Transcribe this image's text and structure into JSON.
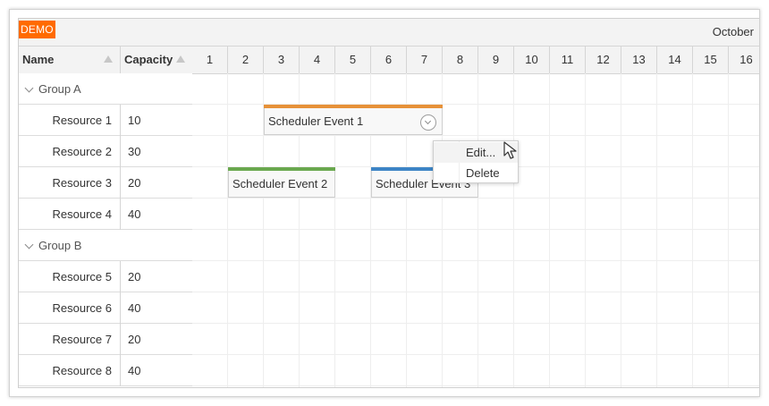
{
  "brand": {
    "demo_label": "DEMO"
  },
  "columns": {
    "name": "Name",
    "capacity": "Capacity"
  },
  "timeline": {
    "month": "October",
    "days": [
      "1",
      "2",
      "3",
      "4",
      "5",
      "6",
      "7",
      "8",
      "9",
      "10",
      "11",
      "12",
      "13",
      "14",
      "15",
      "16"
    ]
  },
  "groups": [
    {
      "label": "Group A",
      "resources": [
        {
          "name": "Resource 1",
          "capacity": "10"
        },
        {
          "name": "Resource 2",
          "capacity": "30"
        },
        {
          "name": "Resource 3",
          "capacity": "20"
        },
        {
          "name": "Resource 4",
          "capacity": "40"
        }
      ]
    },
    {
      "label": "Group B",
      "resources": [
        {
          "name": "Resource 5",
          "capacity": "20"
        },
        {
          "name": "Resource 6",
          "capacity": "40"
        },
        {
          "name": "Resource 7",
          "capacity": "20"
        },
        {
          "name": "Resource 8",
          "capacity": "40"
        }
      ]
    }
  ],
  "events": [
    {
      "label": "Scheduler Event 1",
      "color": "#e69138"
    },
    {
      "label": "Scheduler Event 2",
      "color": "#6aa84f"
    },
    {
      "label": "Scheduler Event 3",
      "color": "#3d85c6"
    }
  ],
  "context_menu": {
    "items": [
      "Edit...",
      "Delete"
    ]
  },
  "colors": {
    "demo_badge": "#ff6a00"
  }
}
